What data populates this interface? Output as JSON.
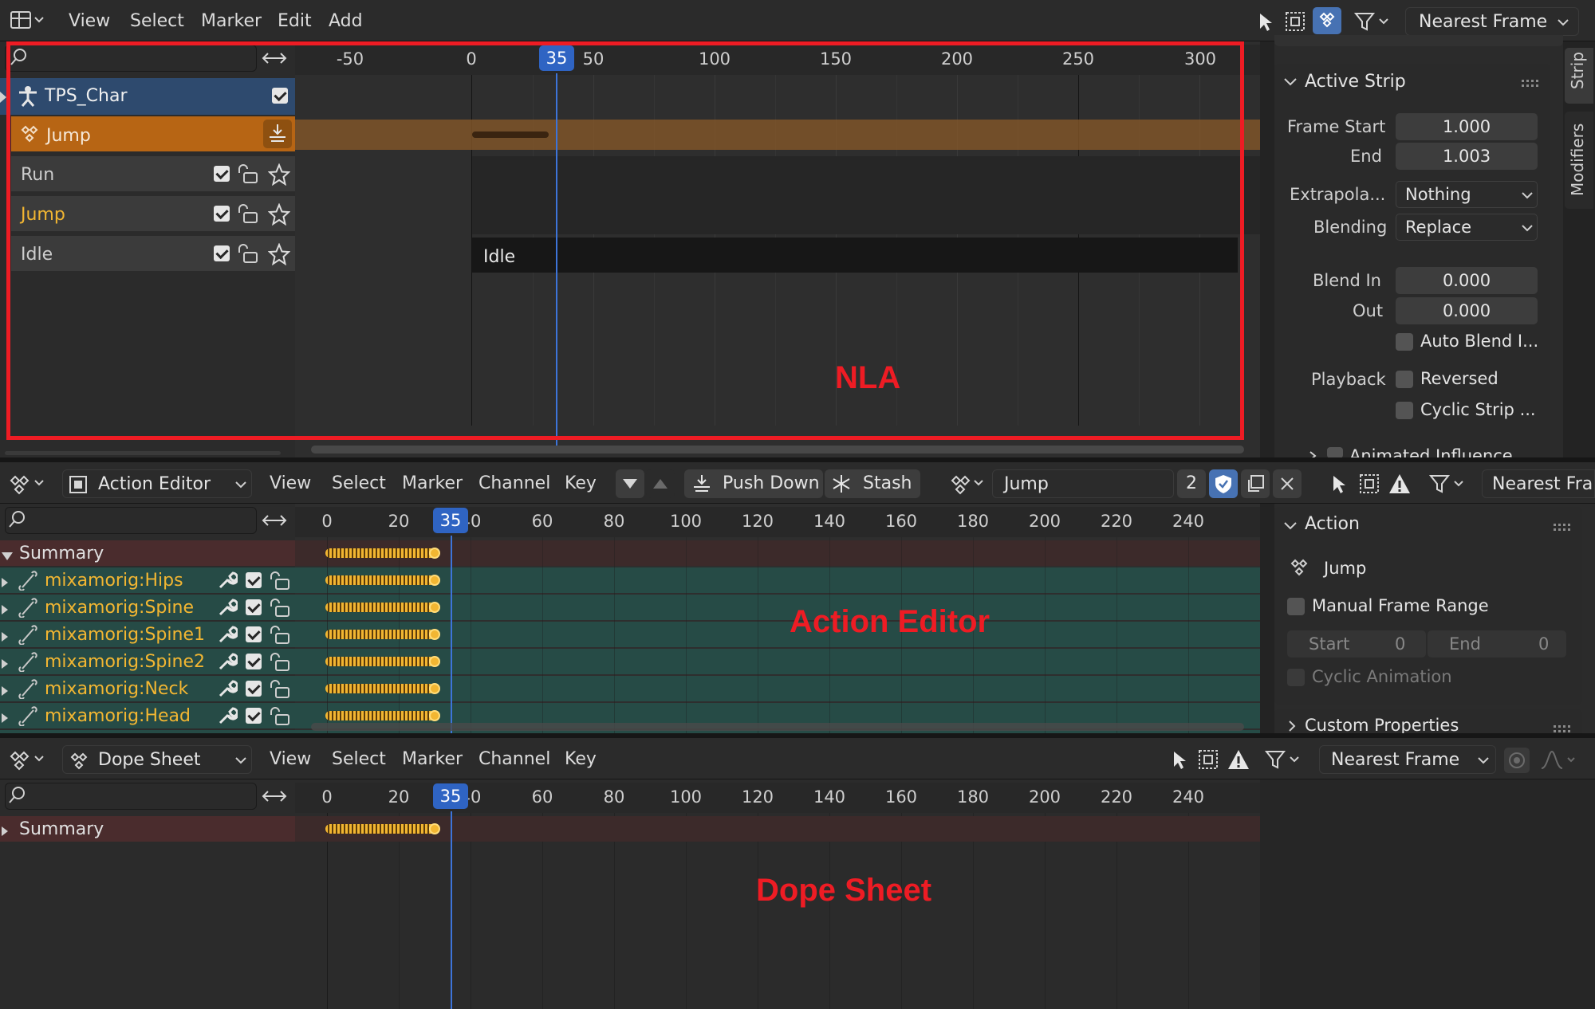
{
  "top_header": {
    "menus": [
      "View",
      "Select",
      "Marker",
      "Edit",
      "Add"
    ],
    "snap_mode": "Nearest Frame"
  },
  "nla": {
    "ruler_ticks": [
      "-50",
      "0",
      "50",
      "100",
      "150",
      "200",
      "250",
      "300"
    ],
    "current_frame": "35",
    "tracks": [
      {
        "name": "TPS_Char"
      },
      {
        "name": "Jump"
      },
      {
        "name": "Run"
      },
      {
        "name": "Jump"
      },
      {
        "name": "Idle"
      }
    ],
    "strip_label": "Idle",
    "annotation": "NLA"
  },
  "sidebar": {
    "tabs": [
      "Strip",
      "Modifiers"
    ],
    "active_strip": {
      "title": "Active Strip",
      "frame_start_label": "Frame Start",
      "frame_start": "1.000",
      "end_label": "End",
      "end": "1.003",
      "extrapolation_label": "Extrapola...",
      "extrapolation": "Nothing",
      "blending_label": "Blending",
      "blending": "Replace",
      "blend_in_label": "Blend In",
      "blend_in": "0.000",
      "out_label": "Out",
      "out": "0.000",
      "auto_blend": "Auto Blend I...",
      "playback_label": "Playback",
      "reversed": "Reversed",
      "cyclic_strip": "Cyclic Strip ...",
      "animated_influence": "Animated Influence"
    }
  },
  "action_editor": {
    "mode": "Action Editor",
    "menus": [
      "View",
      "Select",
      "Marker",
      "Channel",
      "Key"
    ],
    "push_down": "Push Down",
    "stash": "Stash",
    "action_name": "Jump",
    "users": "2",
    "snap_mode": "Nearest Fran",
    "ruler_ticks": [
      "0",
      "20",
      "40",
      "60",
      "80",
      "100",
      "120",
      "140",
      "160",
      "180",
      "200",
      "220",
      "240"
    ],
    "current_frame": "35",
    "summary": "Summary",
    "channels": [
      "mixamorig:Hips",
      "mixamorig:Spine",
      "mixamorig:Spine1",
      "mixamorig:Spine2",
      "mixamorig:Neck",
      "mixamorig:Head"
    ],
    "annotation": "Action Editor",
    "panel": {
      "title": "Action",
      "action_name": "Jump",
      "manual_frame_range": "Manual Frame Range",
      "start_label": "Start",
      "start": "0",
      "end_label": "End",
      "end": "0",
      "cyclic_animation": "Cyclic Animation",
      "custom_properties": "Custom Properties"
    }
  },
  "dope_sheet": {
    "mode": "Dope Sheet",
    "menus": [
      "View",
      "Select",
      "Marker",
      "Channel",
      "Key"
    ],
    "snap_mode": "Nearest Frame",
    "ruler_ticks": [
      "0",
      "20",
      "40",
      "60",
      "80",
      "100",
      "120",
      "140",
      "160",
      "180",
      "200",
      "220",
      "240"
    ],
    "current_frame": "35",
    "summary": "Summary",
    "annotation": "Dope Sheet"
  }
}
